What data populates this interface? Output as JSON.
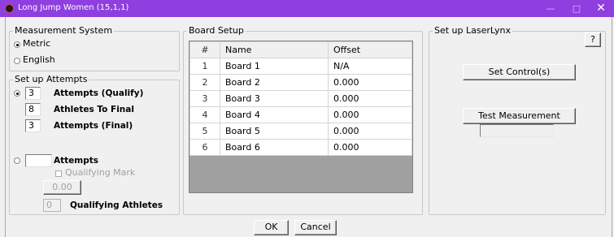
{
  "window": {
    "title": "Long Jump Women (15,1,1)",
    "minimize": "—",
    "maximize": "□",
    "close": "✕"
  },
  "measurement": {
    "legend": "Measurement System",
    "metric": "Metric",
    "english": "English",
    "selected": "Metric"
  },
  "attempts": {
    "legend": "Set up Attempts",
    "qualify_value": "3",
    "qualify_label": "Attempts (Qualify)",
    "athletes_value": "8",
    "athletes_label": "Athletes To Final",
    "final_value": "3",
    "final_label": "Attempts (Final)",
    "alt_value": "",
    "alt_label": "Attempts",
    "qualifying_mark_label": "Qualifying Mark",
    "qualifying_mark_value": "0.00",
    "qualifying_athletes_value": "0",
    "qualifying_athletes_label": "Qualifying Athletes"
  },
  "board": {
    "legend": "Board Setup",
    "columns": [
      "#",
      "Name",
      "Offset"
    ],
    "rows": [
      {
        "num": "1",
        "name": "Board 1",
        "offset": "N/A"
      },
      {
        "num": "2",
        "name": "Board 2",
        "offset": "0.000"
      },
      {
        "num": "3",
        "name": "Board 3",
        "offset": "0.000"
      },
      {
        "num": "4",
        "name": "Board 4",
        "offset": "0.000"
      },
      {
        "num": "5",
        "name": "Board 5",
        "offset": "0.000"
      },
      {
        "num": "6",
        "name": "Board 6",
        "offset": "0.000"
      }
    ]
  },
  "laser": {
    "legend": "Set up LaserLynx",
    "help": "?",
    "set_control": "Set Control(s)",
    "test_measurement": "Test Measurement"
  },
  "footer": {
    "ok": "OK",
    "cancel": "Cancel"
  },
  "colors": {
    "titlebar": "#8f3fe0",
    "grid_empty": "#a0a0a0"
  }
}
